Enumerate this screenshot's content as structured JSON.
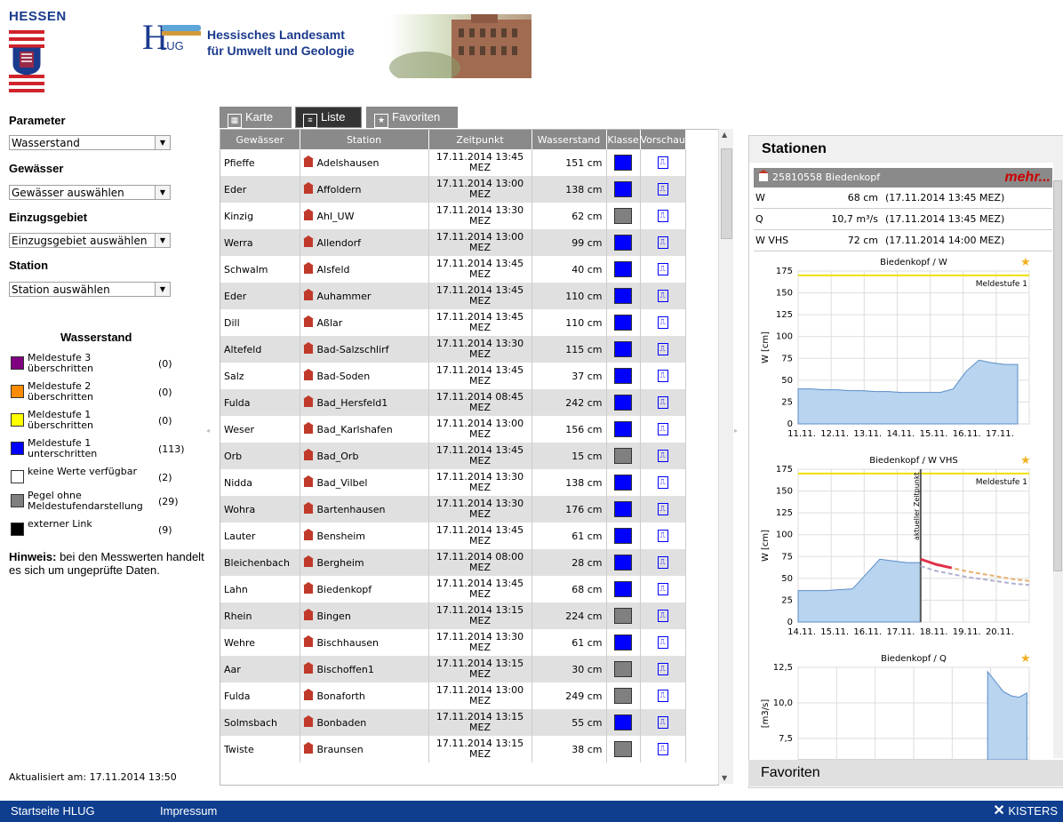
{
  "header": {
    "state": "HESSEN",
    "hlug_abbr": "LUG",
    "hlug_h": "H",
    "org_line1": "Hessisches Landesamt",
    "org_line2": "für Umwelt und Geologie"
  },
  "filters": {
    "parameter_label": "Parameter",
    "parameter_value": "Wasserstand",
    "gewaesser_label": "Gewässer",
    "gewaesser_value": "Gewässer auswählen",
    "einzugsgebiet_label": "Einzugsgebiet",
    "einzugsgebiet_value": "Einzugsgebiet auswählen",
    "station_label": "Station",
    "station_value": "Station auswählen"
  },
  "legend": {
    "title": "Wasserstand",
    "items": [
      {
        "label": "Meldestufe 3 überschritten",
        "count": "(0)",
        "color": "#800080"
      },
      {
        "label": "Meldestufe 2 überschritten",
        "count": "(0)",
        "color": "#ff8c00"
      },
      {
        "label": "Meldestufe 1 überschritten",
        "count": "(0)",
        "color": "#ffff00"
      },
      {
        "label": "Meldestufe 1 unterschritten",
        "count": "(113)",
        "color": "#0000ff"
      },
      {
        "label": "keine Werte verfügbar",
        "count": "(2)",
        "color": "#ffffff"
      },
      {
        "label": "Pegel ohne Meldestufendarstellung",
        "count": "(29)",
        "color": "#808080"
      },
      {
        "label": "externer Link",
        "count": "(9)",
        "color": "#000000"
      }
    ]
  },
  "hinweis": {
    "bold": "Hinweis:",
    "text": " bei den Messwerten handelt es sich um ungeprüfte Daten."
  },
  "updated": "Aktualisiert am: 17.11.2014  13:50",
  "tabs": [
    {
      "label": "Karte",
      "active": false
    },
    {
      "label": "Liste",
      "active": true
    },
    {
      "label": "Favoriten",
      "active": false
    }
  ],
  "table": {
    "headers": [
      "Gewässer",
      "Station",
      "Zeitpunkt",
      "Wasserstand",
      "Klasse",
      "Vorschau"
    ],
    "rows": [
      {
        "gewaesser": "Pfieffe",
        "station": "Adelshausen",
        "date": "17.11.2014 13:45",
        "tz": "MEZ",
        "value": "151 cm",
        "klasse": "#0000ff"
      },
      {
        "gewaesser": "Eder",
        "station": "Affoldern",
        "date": "17.11.2014 13:00",
        "tz": "MEZ",
        "value": "138 cm",
        "klasse": "#0000ff"
      },
      {
        "gewaesser": "Kinzig",
        "station": "Ahl_UW",
        "date": "17.11.2014 13:30",
        "tz": "MEZ",
        "value": "62 cm",
        "klasse": "#808080"
      },
      {
        "gewaesser": "Werra",
        "station": "Allendorf",
        "date": "17.11.2014 13:00",
        "tz": "MEZ",
        "value": "99 cm",
        "klasse": "#0000ff"
      },
      {
        "gewaesser": "Schwalm",
        "station": "Alsfeld",
        "date": "17.11.2014 13:45",
        "tz": "MEZ",
        "value": "40 cm",
        "klasse": "#0000ff"
      },
      {
        "gewaesser": "Eder",
        "station": "Auhammer",
        "date": "17.11.2014 13:45",
        "tz": "MEZ",
        "value": "110 cm",
        "klasse": "#0000ff"
      },
      {
        "gewaesser": "Dill",
        "station": "Aßlar",
        "date": "17.11.2014 13:45",
        "tz": "MEZ",
        "value": "110 cm",
        "klasse": "#0000ff"
      },
      {
        "gewaesser": "Altefeld",
        "station": "Bad-Salzschlirf",
        "date": "17.11.2014 13:30",
        "tz": "MEZ",
        "value": "115 cm",
        "klasse": "#0000ff"
      },
      {
        "gewaesser": "Salz",
        "station": "Bad-Soden",
        "date": "17.11.2014 13:45",
        "tz": "MEZ",
        "value": "37 cm",
        "klasse": "#0000ff"
      },
      {
        "gewaesser": "Fulda",
        "station": "Bad_Hersfeld1",
        "date": "17.11.2014 08:45",
        "tz": "MEZ",
        "value": "242 cm",
        "klasse": "#0000ff"
      },
      {
        "gewaesser": "Weser",
        "station": "Bad_Karlshafen",
        "date": "17.11.2014 13:00",
        "tz": "MEZ",
        "value": "156 cm",
        "klasse": "#0000ff"
      },
      {
        "gewaesser": "Orb",
        "station": "Bad_Orb",
        "date": "17.11.2014 13:45",
        "tz": "MEZ",
        "value": "15 cm",
        "klasse": "#808080"
      },
      {
        "gewaesser": "Nidda",
        "station": "Bad_Vilbel",
        "date": "17.11.2014 13:30",
        "tz": "MEZ",
        "value": "138 cm",
        "klasse": "#0000ff"
      },
      {
        "gewaesser": "Wohra",
        "station": "Bartenhausen",
        "date": "17.11.2014 13:30",
        "tz": "MEZ",
        "value": "176 cm",
        "klasse": "#0000ff"
      },
      {
        "gewaesser": "Lauter",
        "station": "Bensheim",
        "date": "17.11.2014 13:45",
        "tz": "MEZ",
        "value": "61 cm",
        "klasse": "#0000ff"
      },
      {
        "gewaesser": "Bleichenbach",
        "station": "Bergheim",
        "date": "17.11.2014 08:00",
        "tz": "MEZ",
        "value": "28 cm",
        "klasse": "#0000ff"
      },
      {
        "gewaesser": "Lahn",
        "station": "Biedenkopf",
        "date": "17.11.2014 13:45",
        "tz": "MEZ",
        "value": "68 cm",
        "klasse": "#0000ff"
      },
      {
        "gewaesser": "Rhein",
        "station": "Bingen",
        "date": "17.11.2014 13:15",
        "tz": "MEZ",
        "value": "224 cm",
        "klasse": "#808080"
      },
      {
        "gewaesser": "Wehre",
        "station": "Bischhausen",
        "date": "17.11.2014 13:30",
        "tz": "MEZ",
        "value": "61 cm",
        "klasse": "#0000ff"
      },
      {
        "gewaesser": "Aar",
        "station": "Bischoffen1",
        "date": "17.11.2014 13:15",
        "tz": "MEZ",
        "value": "30 cm",
        "klasse": "#808080"
      },
      {
        "gewaesser": "Fulda",
        "station": "Bonaforth",
        "date": "17.11.2014 13:00",
        "tz": "MEZ",
        "value": "249 cm",
        "klasse": "#808080"
      },
      {
        "gewaesser": "Solmsbach",
        "station": "Bonbaden",
        "date": "17.11.2014 13:15",
        "tz": "MEZ",
        "value": "55 cm",
        "klasse": "#0000ff"
      },
      {
        "gewaesser": "Twiste",
        "station": "Braunsen",
        "date": "17.11.2014 13:15",
        "tz": "MEZ",
        "value": "38 cm",
        "klasse": "#808080"
      }
    ]
  },
  "stationen": {
    "title": "Stationen",
    "selected": "25810558 Biedenkopf",
    "mehr": "mehr...",
    "measurements": [
      {
        "param": "W",
        "value": "68 cm",
        "time": "(17.11.2014 13:45 MEZ)"
      },
      {
        "param": "Q",
        "value": "10,7 m³/s",
        "time": "(17.11.2014 13:45 MEZ)"
      },
      {
        "param": "W VHS",
        "value": "72 cm",
        "time": "(17.11.2014 14:00 MEZ)"
      }
    ],
    "favoriten": "Favoriten"
  },
  "chart_data": [
    {
      "type": "area",
      "title": "Biedenkopf / W",
      "ylabel": "W [cm]",
      "ylim": [
        0,
        175
      ],
      "yticks": [
        "0",
        "25",
        "50",
        "75",
        "100",
        "125",
        "150",
        "175"
      ],
      "xticks": [
        "11.11.",
        "12.11.",
        "13.11.",
        "14.11.",
        "15.11.",
        "16.11.",
        "17.11."
      ],
      "threshold": {
        "label": "Meldestufe 1",
        "value": 170
      },
      "series": [
        {
          "values": [
            40,
            40,
            39,
            39,
            38,
            38,
            37,
            37,
            36,
            36,
            36,
            36,
            40,
            60,
            73,
            70,
            68,
            68
          ]
        }
      ]
    },
    {
      "type": "area",
      "title": "Biedenkopf / W VHS",
      "ylabel": "W [cm]",
      "ylim": [
        0,
        175
      ],
      "yticks": [
        "0",
        "25",
        "50",
        "75",
        "100",
        "125",
        "150",
        "175"
      ],
      "xticks": [
        "14.11.",
        "15.11.",
        "16.11.",
        "17.11.",
        "18.11.",
        "19.11.",
        "20.11."
      ],
      "threshold": {
        "label": "Meldestufe 1",
        "value": 170
      },
      "annotation": "aktueller Zeitpunkt",
      "observed": [
        36,
        36,
        36,
        37,
        38,
        55,
        72,
        70,
        68,
        68
      ],
      "forecast": [
        72,
        66,
        62,
        58,
        55,
        52,
        49,
        47
      ]
    },
    {
      "type": "area",
      "title": "Biedenkopf / Q",
      "ylabel": "[m3/s]",
      "ylim": [
        6,
        12.5
      ],
      "yticks": [
        "7,5",
        "10,0",
        "12,5"
      ],
      "series": [
        {
          "values": [
            12.2,
            11.5,
            10.8,
            10.5,
            10.4,
            10.7
          ]
        }
      ]
    }
  ],
  "footer": {
    "home": "Startseite HLUG",
    "impressum": "Impressum",
    "brand": "KISTERS"
  }
}
